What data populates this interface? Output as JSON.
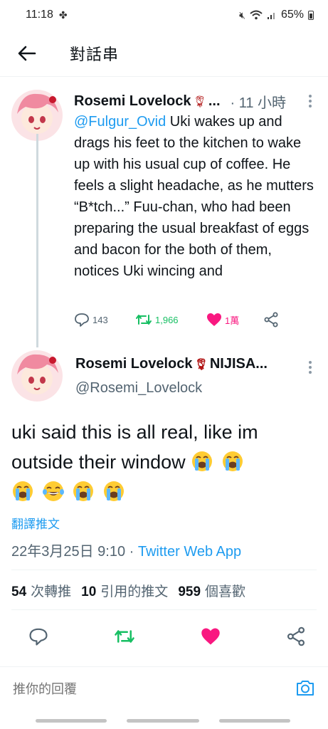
{
  "status_bar": {
    "time": "11:18",
    "battery": "65%"
  },
  "header": {
    "title": "對話串"
  },
  "tweet1": {
    "name": "Rosemi Lovelock",
    "name_suffix": "...",
    "time": "· 11 小時",
    "mention": "@Fulgur_Ovid",
    "text": " Uki wakes up and drags his feet to the kitchen to wake up with his usual cup of coffee. He feels a slight headache, as he mutters “B*tch...” Fuu-chan, who had been preparing the usual breakfast of eggs and bacon for the both of them, notices Uki wincing and",
    "replies": "143",
    "retweets": "1,966",
    "likes": "1萬"
  },
  "tweet2": {
    "name": "Rosemi Lovelock",
    "name_suffix": "NIJISA...",
    "handle": "@Rosemi_Lovelock",
    "text": "uki said this is all real, like im outside their window",
    "translate": "翻譯推文",
    "datetime": "22年3月25日 9:10 · ",
    "source": "Twitter Web App",
    "retweet_count": "54",
    "retweet_label": "次轉推",
    "quote_count": "10",
    "quote_label": "引用的推文",
    "like_count": "959",
    "like_label": "個喜歡"
  },
  "reply": {
    "placeholder": "推你的回覆"
  },
  "icons": {
    "back": "arrow-left-icon",
    "reply": "speech-bubble-icon",
    "retweet": "retweet-icon",
    "like": "heart-icon",
    "share": "share-icon",
    "camera": "camera-icon",
    "emoji": "loudly-crying-face-emoji"
  },
  "colors": {
    "accent": "#1d9bf0",
    "retweet": "#17bf63",
    "like": "#f91880",
    "secondary_text": "#536471"
  }
}
